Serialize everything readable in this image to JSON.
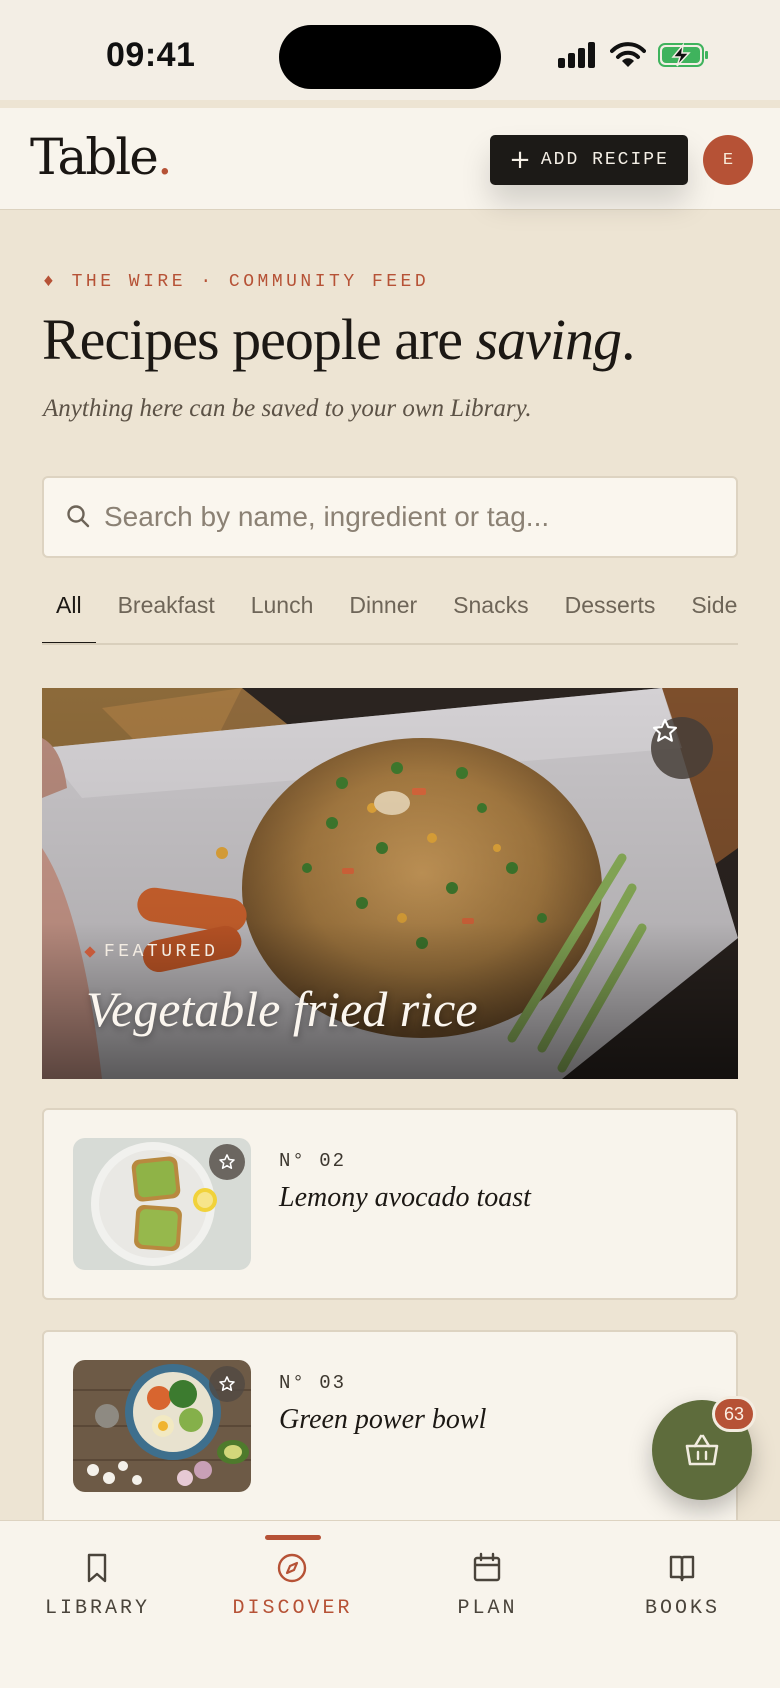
{
  "status": {
    "time": "09:41"
  },
  "header": {
    "logo": "Table",
    "logo_dot": ".",
    "add_button": {
      "icon": "plus-icon",
      "label": "ADD RECIPE"
    },
    "avatar_initial": "E"
  },
  "intro": {
    "eyebrow": "♦ THE WIRE · COMMUNITY FEED",
    "title_main": "Recipes people are ",
    "title_emphasis": "saving",
    "title_end": ".",
    "subtitle": "Anything here can be saved to your own Library."
  },
  "search": {
    "placeholder": "Search by name, ingredient or tag..."
  },
  "tabs": [
    "All",
    "Breakfast",
    "Lunch",
    "Dinner",
    "Snacks",
    "Desserts",
    "Side"
  ],
  "featured": {
    "label": "FEATURED",
    "title": "Vegetable fried rice"
  },
  "recipes": [
    {
      "number": "N° 02",
      "title": "Lemony avocado toast"
    },
    {
      "number": "N° 03",
      "title": "Green power bowl"
    }
  ],
  "basket": {
    "count": "63"
  },
  "nav": [
    {
      "label": "LIBRARY",
      "icon": "bookmark-icon"
    },
    {
      "label": "DISCOVER",
      "icon": "compass-icon"
    },
    {
      "label": "PLAN",
      "icon": "calendar-icon"
    },
    {
      "label": "BOOKS",
      "icon": "book-icon"
    }
  ],
  "colors": {
    "accent": "#b65236",
    "background": "#ede4d3",
    "surface": "#f8f4ec",
    "fab": "#5e6c3c",
    "ink": "#1c1a17"
  }
}
